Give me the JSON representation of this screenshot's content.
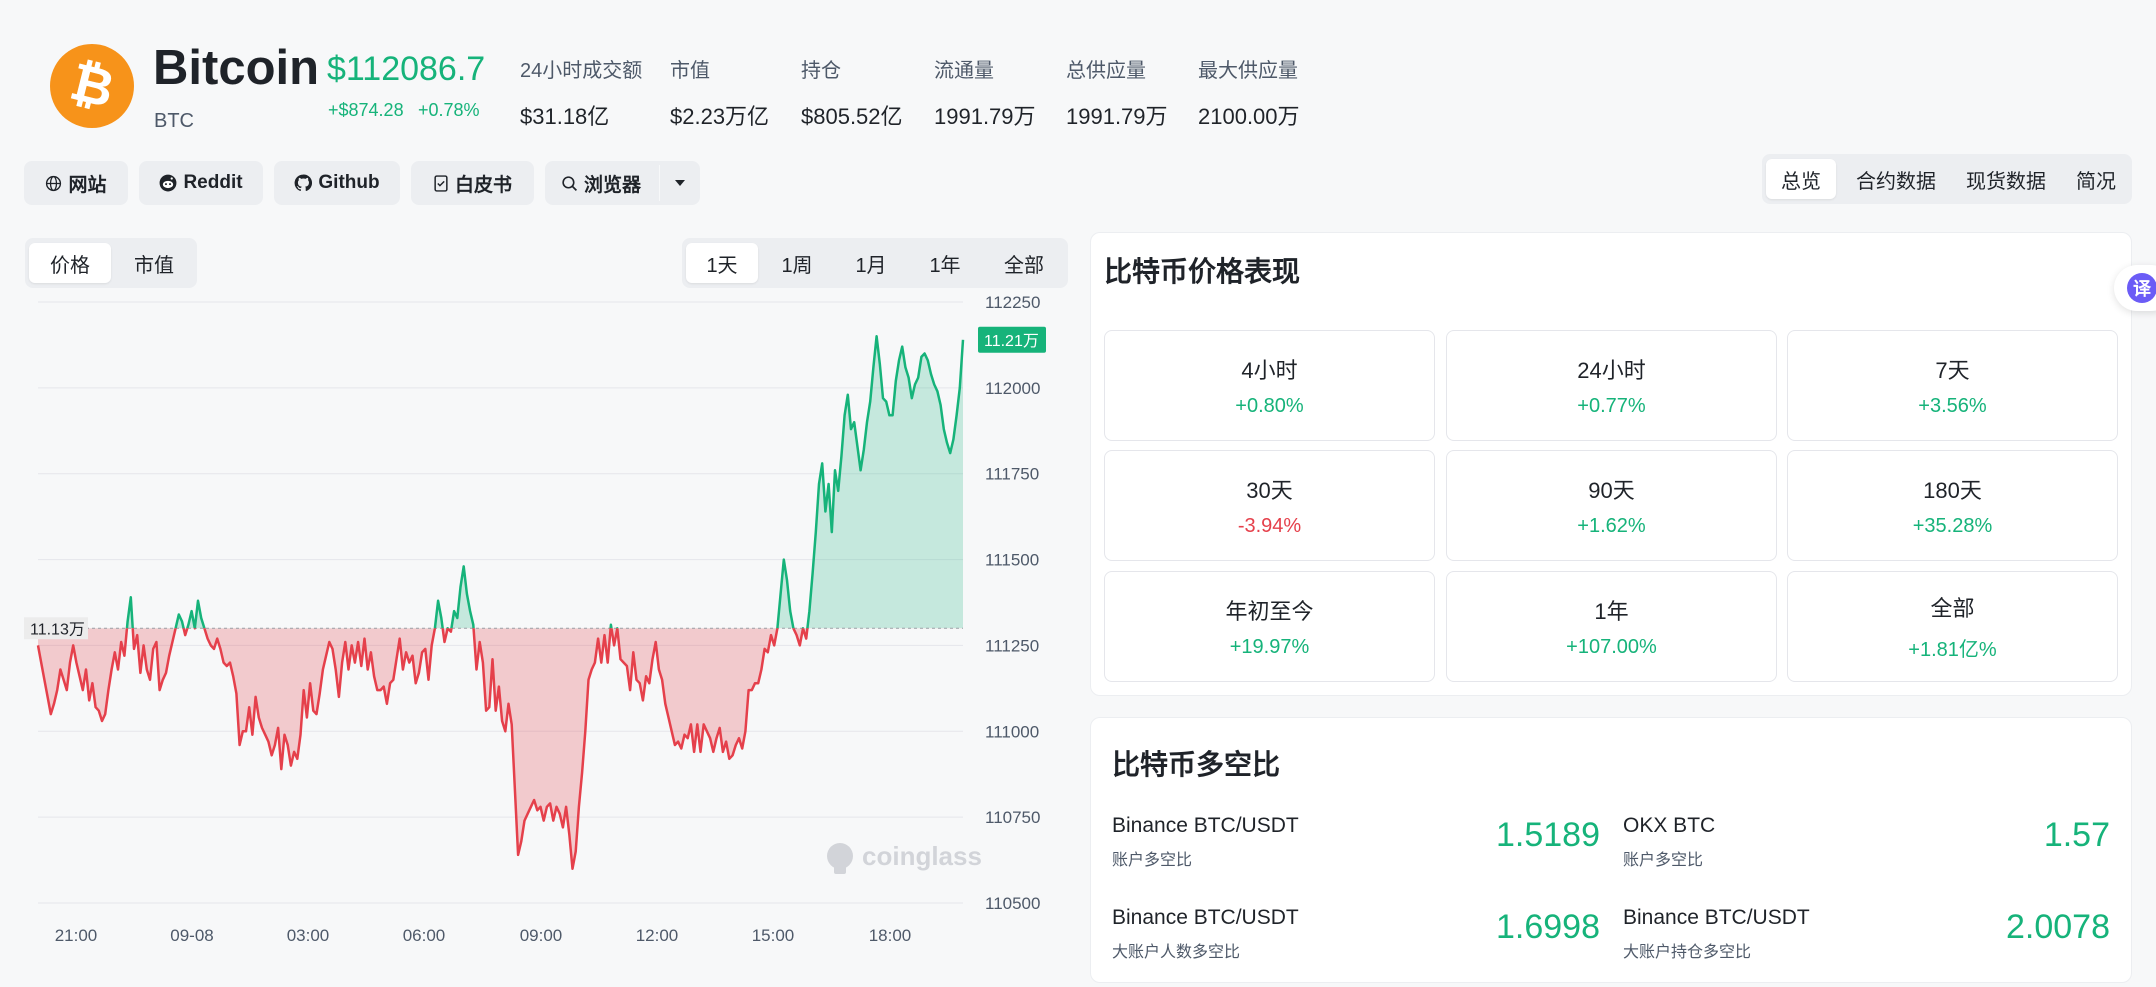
{
  "coin": {
    "name": "Bitcoin",
    "symbol": "BTC",
    "logo_glyph": "₿",
    "price": "$112086.7",
    "change_abs": "+$874.28",
    "change_pct": "+0.78%"
  },
  "stats": [
    {
      "label": "24小时成交额",
      "value": "$31.18亿"
    },
    {
      "label": "市值",
      "value": "$2.23万亿"
    },
    {
      "label": "持仓",
      "value": "$805.52亿"
    },
    {
      "label": "流通量",
      "value": "1991.79万"
    },
    {
      "label": "总供应量",
      "value": "1991.79万"
    },
    {
      "label": "最大供应量",
      "value": "2100.00万"
    }
  ],
  "links": {
    "website": "网站",
    "reddit": "Reddit",
    "github": "Github",
    "whitepaper": "白皮书",
    "explorer": "浏览器"
  },
  "main_tabs": [
    "总览",
    "合约数据",
    "现货数据",
    "简况"
  ],
  "chart_tabs": {
    "metric": [
      "价格",
      "市值"
    ],
    "range": [
      "1天",
      "1周",
      "1月",
      "1年",
      "全部"
    ]
  },
  "chart_data": {
    "type": "area",
    "baseline_value": 111300,
    "baseline_label": "11.13万",
    "current_label": "11.21万",
    "ylim": [
      110500,
      112250
    ],
    "y_ticks": [
      112250,
      112000,
      111750,
      111500,
      111250,
      111000,
      110750,
      110500
    ],
    "x_ticks": [
      "21:00",
      "09-08",
      "03:00",
      "06:00",
      "09:00",
      "12:00",
      "15:00",
      "18:00"
    ],
    "watermark": "coinglass",
    "colors": {
      "up": "#16b37a",
      "down": "#e5404b"
    },
    "y": [
      111250,
      111200,
      111150,
      111100,
      111050,
      111080,
      111120,
      111180,
      111150,
      111120,
      111200,
      111250,
      111200,
      111160,
      111120,
      111180,
      111090,
      111140,
      111070,
      111060,
      111030,
      111050,
      111120,
      111180,
      111230,
      111180,
      111260,
      111220,
      111320,
      111390,
      111240,
      111280,
      111170,
      111250,
      111180,
      111150,
      111240,
      111260,
      111120,
      111150,
      111170,
      111220,
      111260,
      111300,
      111340,
      111320,
      111280,
      111310,
      111350,
      111300,
      111380,
      111330,
      111300,
      111270,
      111250,
      111240,
      111270,
      111240,
      111200,
      111190,
      111200,
      111160,
      111110,
      110960,
      111000,
      111000,
      111070,
      110990,
      111100,
      111040,
      111010,
      110990,
      110970,
      110930,
      110960,
      111010,
      110890,
      110990,
      110960,
      110900,
      110940,
      110920,
      110990,
      111120,
      111040,
      111140,
      111060,
      111050,
      111110,
      111180,
      111220,
      111260,
      111240,
      111180,
      111100,
      111200,
      111260,
      111180,
      111250,
      111200,
      111260,
      111190,
      111270,
      111180,
      111230,
      111160,
      111120,
      111120,
      111130,
      111080,
      111140,
      111150,
      111210,
      111270,
      111180,
      111230,
      111200,
      111220,
      111140,
      111170,
      111230,
      111240,
      111150,
      111250,
      111300,
      111380,
      111330,
      111260,
      111300,
      111290,
      111350,
      111330,
      111420,
      111480,
      111400,
      111350,
      111310,
      111180,
      111260,
      111200,
      111060,
      111070,
      111210,
      111060,
      111130,
      111030,
      111000,
      111080,
      111020,
      110830,
      110640,
      110680,
      110740,
      110760,
      110780,
      110800,
      110770,
      110780,
      110740,
      110780,
      110790,
      110740,
      110780,
      110760,
      110720,
      110780,
      110700,
      110600,
      110650,
      110780,
      110880,
      111000,
      111150,
      111180,
      111200,
      111270,
      111200,
      111280,
      111200,
      111310,
      111250,
      111300,
      111210,
      111200,
      111190,
      111120,
      111230,
      111150,
      111140,
      111090,
      111160,
      111140,
      111210,
      111260,
      111180,
      111150,
      111080,
      111040,
      111000,
      110960,
      110970,
      110950,
      110990,
      110980,
      111020,
      110940,
      111020,
      110940,
      111020,
      111000,
      110980,
      110940,
      110980,
      111010,
      110940,
      110970,
      110920,
      110930,
      110960,
      110980,
      110950,
      111000,
      111120,
      111120,
      111140,
      111140,
      111180,
      111240,
      111230,
      111280,
      111250,
      111300,
      111400,
      111500,
      111440,
      111350,
      111300,
      111280,
      111250,
      111300,
      111270,
      111350,
      111460,
      111580,
      111720,
      111780,
      111640,
      111720,
      111580,
      111760,
      111700,
      111800,
      111920,
      111980,
      111880,
      111900,
      111830,
      111760,
      111820,
      111900,
      111960,
      112060,
      112150,
      112070,
      111970,
      111960,
      111920,
      111920,
      112020,
      112080,
      112120,
      112060,
      112030,
      111970,
      112010,
      112030,
      112090,
      112100,
      112080,
      112040,
      112010,
      111990,
      111950,
      111880,
      111840,
      111810,
      111850,
      111920,
      112000,
      112140
    ]
  },
  "performance": {
    "title": "比特币价格表现",
    "cells": [
      {
        "label": "4小时",
        "value": "+0.80%",
        "dir": "pos"
      },
      {
        "label": "24小时",
        "value": "+0.77%",
        "dir": "pos"
      },
      {
        "label": "7天",
        "value": "+3.56%",
        "dir": "pos"
      },
      {
        "label": "30天",
        "value": "-3.94%",
        "dir": "neg"
      },
      {
        "label": "90天",
        "value": "+1.62%",
        "dir": "pos"
      },
      {
        "label": "180天",
        "value": "+35.28%",
        "dir": "pos"
      },
      {
        "label": "年初至今",
        "value": "+19.97%",
        "dir": "pos"
      },
      {
        "label": "1年",
        "value": "+107.00%",
        "dir": "pos"
      },
      {
        "label": "全部",
        "value": "+1.81亿%",
        "dir": "pos"
      }
    ]
  },
  "long_short": {
    "title": "比特币多空比",
    "items": [
      {
        "name": "Binance BTC/USDT",
        "sub": "账户多空比",
        "value": "1.5189"
      },
      {
        "name": "OKX BTC",
        "sub": "账户多空比",
        "value": "1.57"
      },
      {
        "name": "Binance BTC/USDT",
        "sub": "大账户人数多空比",
        "value": "1.6998"
      },
      {
        "name": "Binance BTC/USDT",
        "sub": "大账户持仓多空比",
        "value": "2.0078"
      }
    ]
  },
  "translate_label": "译"
}
